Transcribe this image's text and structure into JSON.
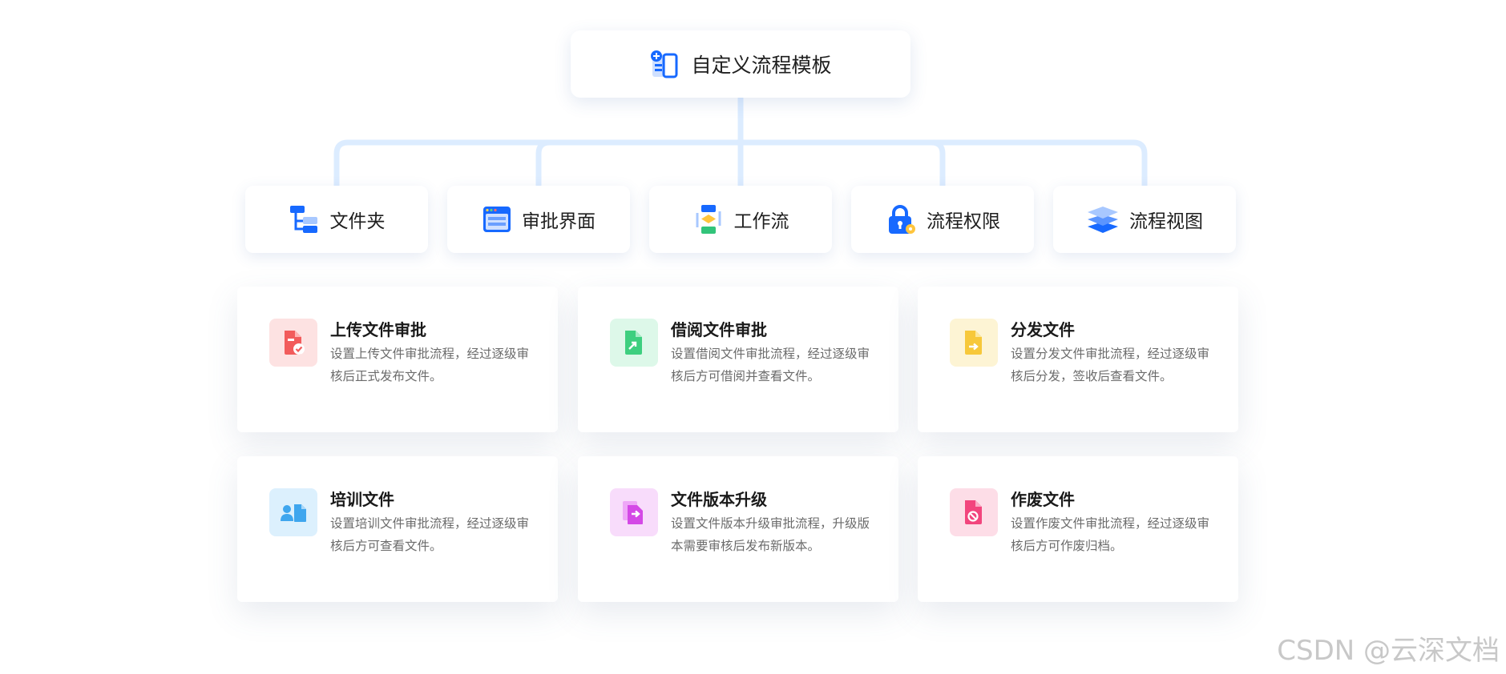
{
  "root": {
    "title": "自定义流程模板",
    "icon": "template-add-icon"
  },
  "categories": [
    {
      "label": "文件夹",
      "icon": "folder-tree-icon"
    },
    {
      "label": "审批界面",
      "icon": "approval-window-icon"
    },
    {
      "label": "工作流",
      "icon": "workflow-icon"
    },
    {
      "label": "流程权限",
      "icon": "lock-icon"
    },
    {
      "label": "流程视图",
      "icon": "layers-icon"
    }
  ],
  "cards": [
    {
      "title": "上传文件审批",
      "desc": "设置上传文件审批流程，经过逐级审核后正式发布文件。",
      "icon": "file-check-icon",
      "color": "#f25c5c",
      "bg": "#fde2e2"
    },
    {
      "title": "借阅文件审批",
      "desc": "设置借阅文件审批流程，经过逐级审核后方可借阅并查看文件。",
      "icon": "file-share-icon",
      "color": "#3ecf7f",
      "bg": "#ddf8e9"
    },
    {
      "title": "分发文件",
      "desc": "设置分发文件审批流程，经过逐级审核后分发，签收后查看文件。",
      "icon": "file-send-icon",
      "color": "#f7c83a",
      "bg": "#fdf4d4"
    },
    {
      "title": "培训文件",
      "desc": "设置培训文件审批流程，经过逐级审核后方可查看文件。",
      "icon": "training-user-icon",
      "color": "#3fa6ee",
      "bg": "#dcf0fd"
    },
    {
      "title": "文件版本升级",
      "desc": "设置文件版本升级审批流程，升级版本需要审核后发布新版本。",
      "icon": "file-upgrade-icon",
      "color": "#d449e6",
      "bg": "#f8dcfb"
    },
    {
      "title": "作废文件",
      "desc": "设置作废文件审批流程，经过逐级审核后方可作废归档。",
      "icon": "file-void-icon",
      "color": "#f2457d",
      "bg": "#fddde7"
    }
  ],
  "colors": {
    "connector": "#dcecff",
    "primary_blue": "#1769ff"
  },
  "watermark": "CSDN @云深文档"
}
